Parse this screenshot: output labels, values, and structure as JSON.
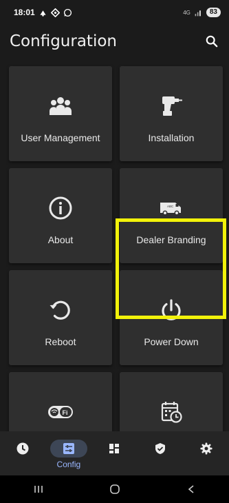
{
  "status_bar": {
    "time": "18:01",
    "network": "4G",
    "battery": "83"
  },
  "header": {
    "title": "Configuration",
    "search_icon": "search-icon"
  },
  "tiles": [
    {
      "label": "User Management",
      "icon": "users-icon"
    },
    {
      "label": "Installation",
      "icon": "drill-icon"
    },
    {
      "label": "About",
      "icon": "info-icon"
    },
    {
      "label": "Dealer Branding",
      "icon": "van-icon",
      "van_text": "ABC"
    },
    {
      "label": "Reboot",
      "icon": "reboot-icon"
    },
    {
      "label": "Power Down",
      "icon": "power-icon"
    },
    {
      "label": "",
      "icon": "wifi-icon",
      "wifi_text": "Fi"
    },
    {
      "label": "",
      "icon": "calendar-clock-icon"
    }
  ],
  "bottom_nav": {
    "items": [
      {
        "icon": "clock-icon",
        "label": ""
      },
      {
        "icon": "config-icon",
        "label": "Config",
        "active": true
      },
      {
        "icon": "dashboard-icon",
        "label": ""
      },
      {
        "icon": "shield-icon",
        "label": ""
      },
      {
        "icon": "gear-icon",
        "label": ""
      }
    ]
  },
  "system_nav": {
    "items": [
      "recents-icon",
      "home-icon",
      "back-icon"
    ]
  },
  "colors": {
    "highlight": "#f2f20a",
    "accent": "#9ab7ff",
    "tile": "#2f2f2f",
    "background": "#1b1b1b"
  }
}
